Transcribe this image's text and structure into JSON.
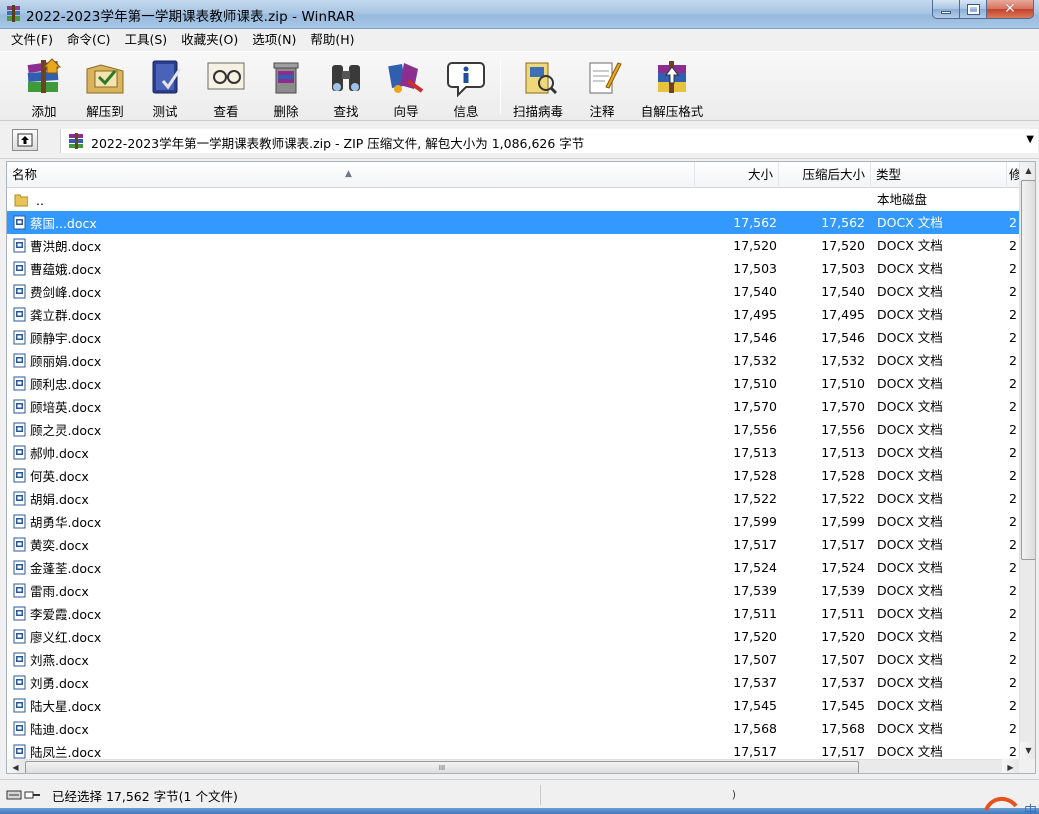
{
  "window": {
    "title": "2022-2023学年第一学期课表教师课表.zip - WinRAR",
    "close_glyph": "✕"
  },
  "menu": [
    "文件(F)",
    "命令(C)",
    "工具(S)",
    "收藏夹(O)",
    "选项(N)",
    "帮助(H)"
  ],
  "toolbar": [
    {
      "label": "添加",
      "icon": "add-archive-icon"
    },
    {
      "label": "解压到",
      "icon": "extract-to-icon"
    },
    {
      "label": "测试",
      "icon": "test-icon"
    },
    {
      "label": "查看",
      "icon": "view-icon"
    },
    {
      "label": "删除",
      "icon": "delete-icon"
    },
    {
      "label": "查找",
      "icon": "find-icon"
    },
    {
      "label": "向导",
      "icon": "wizard-icon"
    },
    {
      "label": "信息",
      "icon": "info-icon"
    },
    {
      "label": "扫描病毒",
      "icon": "virus-scan-icon"
    },
    {
      "label": "注释",
      "icon": "comment-icon"
    },
    {
      "label": "自解压格式",
      "icon": "sfx-icon"
    }
  ],
  "path_bar": {
    "text": "2022-2023学年第一学期课表教师课表.zip - ZIP 压缩文件, 解包大小为 1,086,626 字节"
  },
  "columns": {
    "name": "名称",
    "size": "大小",
    "packed": "压缩后大小",
    "type": "类型",
    "modified": "修"
  },
  "parent_row": {
    "name": "..",
    "type": "本地磁盘"
  },
  "files": [
    {
      "name": "蔡国...docx",
      "size": "17,562",
      "packed": "17,562",
      "type": "DOCX 文档",
      "mod": "2",
      "selected": true
    },
    {
      "name": "曹洪朗.docx",
      "size": "17,520",
      "packed": "17,520",
      "type": "DOCX 文档",
      "mod": "2"
    },
    {
      "name": "曹蕴娥.docx",
      "size": "17,503",
      "packed": "17,503",
      "type": "DOCX 文档",
      "mod": "2"
    },
    {
      "name": "费剑峰.docx",
      "size": "17,540",
      "packed": "17,540",
      "type": "DOCX 文档",
      "mod": "2"
    },
    {
      "name": "龚立群.docx",
      "size": "17,495",
      "packed": "17,495",
      "type": "DOCX 文档",
      "mod": "2"
    },
    {
      "name": "顾静宇.docx",
      "size": "17,546",
      "packed": "17,546",
      "type": "DOCX 文档",
      "mod": "2"
    },
    {
      "name": "顾丽娟.docx",
      "size": "17,532",
      "packed": "17,532",
      "type": "DOCX 文档",
      "mod": "2"
    },
    {
      "name": "顾利忠.docx",
      "size": "17,510",
      "packed": "17,510",
      "type": "DOCX 文档",
      "mod": "2"
    },
    {
      "name": "顾培英.docx",
      "size": "17,570",
      "packed": "17,570",
      "type": "DOCX 文档",
      "mod": "2"
    },
    {
      "name": "顾之灵.docx",
      "size": "17,556",
      "packed": "17,556",
      "type": "DOCX 文档",
      "mod": "2"
    },
    {
      "name": "郝帅.docx",
      "size": "17,513",
      "packed": "17,513",
      "type": "DOCX 文档",
      "mod": "2"
    },
    {
      "name": "何英.docx",
      "size": "17,528",
      "packed": "17,528",
      "type": "DOCX 文档",
      "mod": "2"
    },
    {
      "name": "胡娟.docx",
      "size": "17,522",
      "packed": "17,522",
      "type": "DOCX 文档",
      "mod": "2"
    },
    {
      "name": "胡勇华.docx",
      "size": "17,599",
      "packed": "17,599",
      "type": "DOCX 文档",
      "mod": "2"
    },
    {
      "name": "黄奕.docx",
      "size": "17,517",
      "packed": "17,517",
      "type": "DOCX 文档",
      "mod": "2"
    },
    {
      "name": "金蓬荃.docx",
      "size": "17,524",
      "packed": "17,524",
      "type": "DOCX 文档",
      "mod": "2"
    },
    {
      "name": "雷雨.docx",
      "size": "17,539",
      "packed": "17,539",
      "type": "DOCX 文档",
      "mod": "2"
    },
    {
      "name": "李爱霞.docx",
      "size": "17,511",
      "packed": "17,511",
      "type": "DOCX 文档",
      "mod": "2"
    },
    {
      "name": "廖义红.docx",
      "size": "17,520",
      "packed": "17,520",
      "type": "DOCX 文档",
      "mod": "2"
    },
    {
      "name": "刘燕.docx",
      "size": "17,507",
      "packed": "17,507",
      "type": "DOCX 文档",
      "mod": "2"
    },
    {
      "name": "刘勇.docx",
      "size": "17,537",
      "packed": "17,537",
      "type": "DOCX 文档",
      "mod": "2"
    },
    {
      "name": "陆大星.docx",
      "size": "17,545",
      "packed": "17,545",
      "type": "DOCX 文档",
      "mod": "2"
    },
    {
      "name": "陆迪.docx",
      "size": "17,568",
      "packed": "17,568",
      "type": "DOCX 文档",
      "mod": "2"
    },
    {
      "name": "陆凤兰.docx",
      "size": "17,517",
      "packed": "17,517",
      "type": "DOCX 文档",
      "mod": "2"
    }
  ],
  "scrollbar": {
    "grip": "III"
  },
  "status": {
    "text": "已经选择 17,562 字节(1 个文件)",
    "right": ")"
  },
  "ime": {
    "label": "中"
  },
  "colors": {
    "selection": "#3399ff",
    "docx_icon": "#2b5797",
    "titlebar": "#a9c6e4"
  }
}
